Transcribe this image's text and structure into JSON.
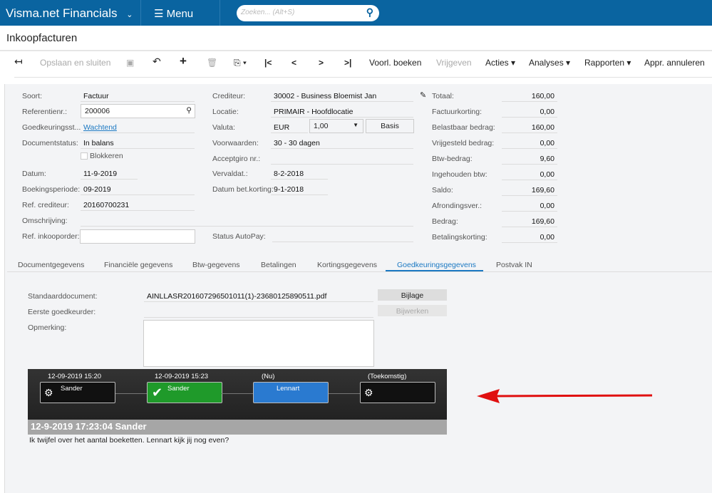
{
  "header": {
    "app_title": "Visma.net Financials",
    "menu_label": "Menu",
    "search_placeholder": "Zoeken... (Alt+S)"
  },
  "page_title": "Inkoopfacturen",
  "toolbar": {
    "save_close": "Opslaan en sluiten",
    "voorl_boeken": "Voorl. boeken",
    "vrijgeven": "Vrijgeven",
    "acties": "Acties",
    "analyses": "Analyses",
    "rapporten": "Rapporten",
    "appr_annuleren": "Appr. annuleren"
  },
  "form": {
    "soort": {
      "label": "Soort:",
      "value": "Factuur"
    },
    "referentie": {
      "label": "Referentienr.:",
      "value": "200006"
    },
    "goedkeuring": {
      "label": "Goedkeuringsst...",
      "value": "Wachtend"
    },
    "docstatus": {
      "label": "Documentstatus:",
      "value": "In balans"
    },
    "blokkeren": {
      "label": "Blokkeren",
      "checked": false
    },
    "datum": {
      "label": "Datum:",
      "value": "11-9-2019"
    },
    "periode": {
      "label": "Boekingsperiode:",
      "value": "09-2019"
    },
    "refcred": {
      "label": "Ref. crediteur:",
      "value": "20160700231"
    },
    "omschrijving": {
      "label": "Omschrijving:",
      "value": ""
    },
    "refinkoop": {
      "label": "Ref. inkooporder:",
      "value": ""
    },
    "crediteur": {
      "label": "Crediteur:",
      "value": "30002 - Business Bloemist Jan"
    },
    "locatie": {
      "label": "Locatie:",
      "value": "PRIMAIR - Hoofdlocatie"
    },
    "valuta": {
      "label": "Valuta:",
      "value": "EUR",
      "rate": "1,00",
      "basis": "Basis"
    },
    "voorwaarden": {
      "label": "Voorwaarden:",
      "value": "30 - 30 dagen"
    },
    "acceptgiro": {
      "label": "Acceptgiro nr.:",
      "value": ""
    },
    "vervaldat": {
      "label": "Vervaldat.:",
      "value": "8-2-2018"
    },
    "datumkorting": {
      "label": "Datum bet.korting:",
      "value": "9-1-2018"
    },
    "autopay": {
      "label": "Status AutoPay:",
      "value": ""
    }
  },
  "totals": [
    {
      "label": "Totaal:",
      "value": "160,00"
    },
    {
      "label": "Factuurkorting:",
      "value": "0,00"
    },
    {
      "label": "Belastbaar bedrag:",
      "value": "160,00"
    },
    {
      "label": "Vrijgesteld bedrag:",
      "value": "0,00"
    },
    {
      "label": "Btw-bedrag:",
      "value": "9,60"
    },
    {
      "label": "Ingehouden btw:",
      "value": "0,00"
    },
    {
      "label": "Saldo:",
      "value": "169,60"
    },
    {
      "label": "Afrondingsver.:",
      "value": "0,00"
    },
    {
      "label": "Bedrag:",
      "value": "169,60"
    },
    {
      "label": "Betalingskorting:",
      "value": "0,00"
    }
  ],
  "tabs": [
    "Documentgegevens",
    "Financiële gegevens",
    "Btw-gegevens",
    "Betalingen",
    "Kortingsgegevens",
    "Goedkeuringsgegevens",
    "Postvak IN"
  ],
  "active_tab": "Goedkeuringsgegevens",
  "approval": {
    "standaarddoc": {
      "label": "Standaarddocument:",
      "value": "AINLLASR201607296501011(1)-23680125890511.pdf"
    },
    "eerste": {
      "label": "Eerste goedkeurder:",
      "value": ""
    },
    "opmerking": {
      "label": "Opmerking:",
      "value": ""
    },
    "bijlage": "Bijlage",
    "bijwerken": "Bijwerken"
  },
  "workflow": {
    "nodes": [
      {
        "time": "12-09-2019 15:20",
        "name": "Sander",
        "state": "done-gear"
      },
      {
        "time": "12-09-2019 15:23",
        "name": "Sander",
        "state": "approved"
      },
      {
        "time": "(Nu)",
        "name": "Lennart",
        "state": "current"
      },
      {
        "time": "(Toekomstig)",
        "name": "",
        "state": "future"
      }
    ],
    "comment_header": "12-9-2019 17:23:04 Sander",
    "comment": "Ik twijfel over het aantal boeketten. Lennart kijk jij nog even?"
  },
  "colors": {
    "brand": "#0a64a0",
    "approved": "#1f9a2a",
    "current": "#2a7ad0",
    "arrow": "#e01010"
  }
}
